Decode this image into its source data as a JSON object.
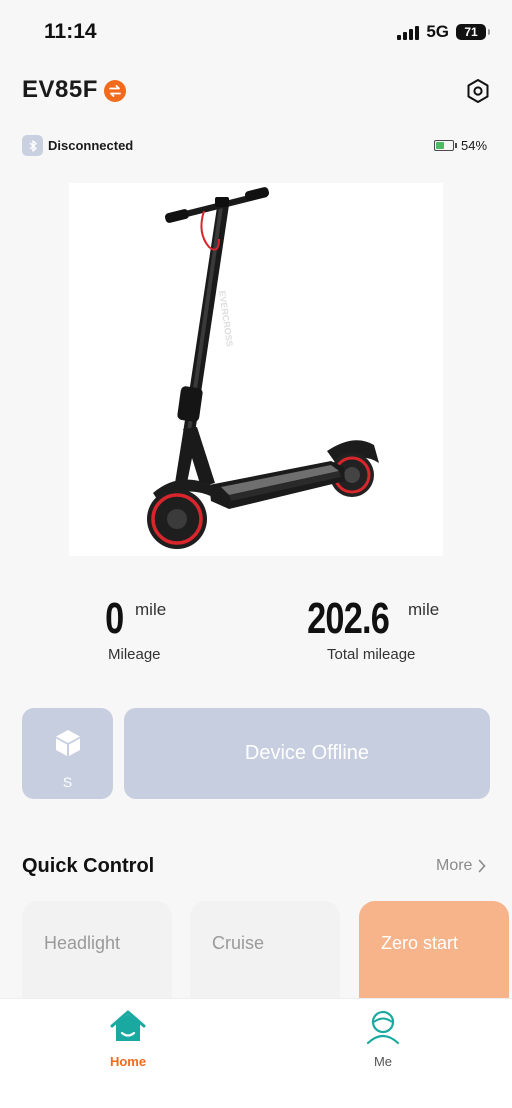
{
  "status_bar": {
    "time": "11:14",
    "network": "5G",
    "battery": "71"
  },
  "header": {
    "device_name": "EV85F"
  },
  "connection": {
    "status": "Disconnected",
    "battery_percent": "54%",
    "battery_level": 0.54
  },
  "stats": {
    "mileage": {
      "value": "0",
      "unit": "mile",
      "label": "Mileage"
    },
    "total": {
      "value": "202.6",
      "unit": "mile",
      "label": "Total mileage"
    }
  },
  "mode": {
    "label": "S"
  },
  "device_status": {
    "label": "Device Offline"
  },
  "quick_control": {
    "title": "Quick Control",
    "more": "More",
    "items": [
      {
        "label": "Headlight",
        "active": false
      },
      {
        "label": "Cruise",
        "active": false
      },
      {
        "label": "Zero start",
        "active": true
      }
    ]
  },
  "nav": {
    "home": "Home",
    "me": "Me"
  },
  "colors": {
    "accent": "#f26b1d",
    "disabled": "#c7cedf",
    "active_card": "#f7b48b"
  }
}
